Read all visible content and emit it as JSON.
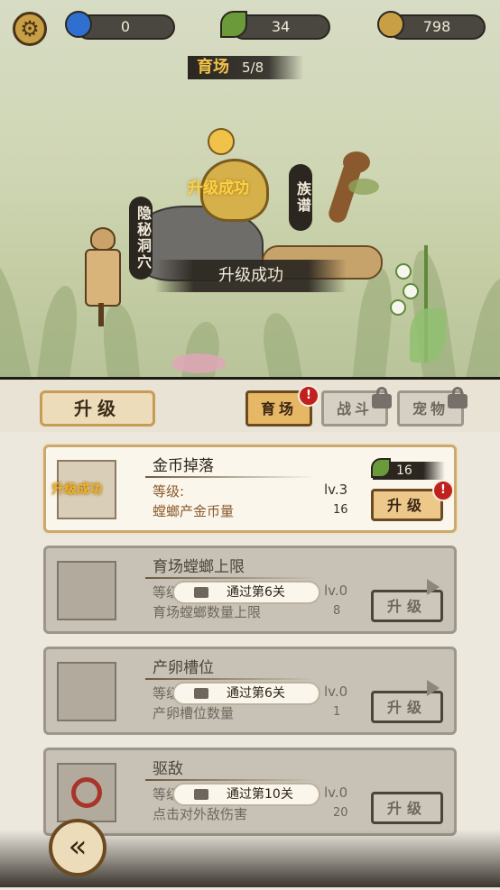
{
  "top_bar": {
    "settings_icon": "gear-icon",
    "gems": {
      "icon": "blue-gem-icon",
      "value": "0",
      "color": "#2f6fd0"
    },
    "leaves": {
      "icon": "leaf-icon",
      "value": "34",
      "color": "#6b9a3a"
    },
    "coins": {
      "icon": "coin-icon",
      "value": "798",
      "color": "#c99f45"
    }
  },
  "scene": {
    "banner_title": "育场",
    "banner_count": "5/8",
    "sign_left": "隐秘洞穴",
    "sign_right": "族谱",
    "upgrade_effect_text": "升级成功",
    "toast": "升级成功"
  },
  "panel": {
    "title": "升级",
    "tabs": [
      {
        "label": "育场",
        "active": true,
        "badge": "!"
      },
      {
        "label": "战斗",
        "active": false,
        "locked": true
      },
      {
        "label": "宠物",
        "active": false,
        "locked": true
      }
    ]
  },
  "upgrades": [
    {
      "name": "金币掉落",
      "level_label": "等级:",
      "level": "lv.3",
      "desc": "螳螂产金币量",
      "value": "16",
      "cost": "16",
      "button": "升级",
      "badge": "!",
      "thumb_effect": "升级成功",
      "status": "active"
    },
    {
      "name": "育场螳螂上限",
      "level_label": "等级:",
      "level": "lv.0",
      "desc": "育场螳螂数量上限",
      "value": "8",
      "button": "升级",
      "lock_text": "通过第6关",
      "status": "locked"
    },
    {
      "name": "产卵槽位",
      "level_label": "等级:",
      "level": "lv.0",
      "desc": "产卵槽位数量",
      "value": "1",
      "button": "升级",
      "lock_text": "通过第6关",
      "status": "locked"
    },
    {
      "name": "驱敌",
      "level_label": "等级:",
      "level": "lv.0",
      "desc": "点击对外敌伤害",
      "value": "20",
      "button": "升级",
      "lock_text": "通过第10关",
      "status": "locked"
    }
  ],
  "back_button_icon": "back-arrow-icon"
}
